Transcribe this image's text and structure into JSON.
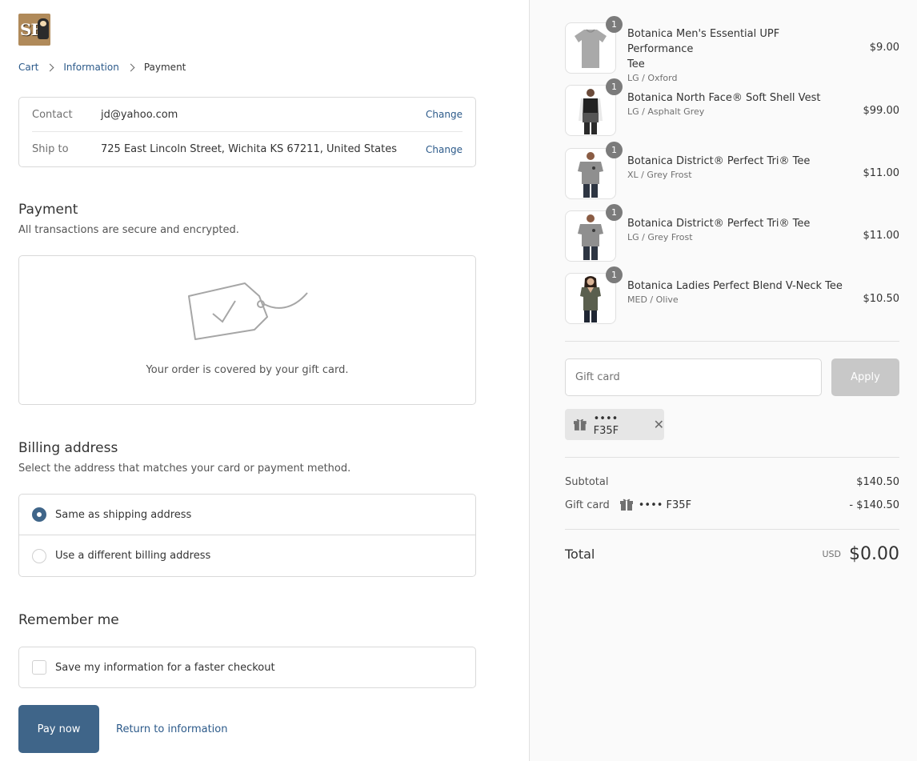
{
  "logo": {
    "text": "SF"
  },
  "breadcrumb": {
    "cart": "Cart",
    "information": "Information",
    "payment": "Payment"
  },
  "review": {
    "contact_label": "Contact",
    "contact_value": "jd@yahoo.com",
    "ship_label": "Ship to",
    "ship_value": "725 East Lincoln Street, Wichita KS 67211, United States",
    "change_label": "Change"
  },
  "payment": {
    "title": "Payment",
    "subtitle": "All transactions are secure and encrypted.",
    "note": "Your order is covered by your gift card."
  },
  "billing": {
    "title": "Billing address",
    "subtitle": "Select the address that matches your card or payment method.",
    "options": [
      {
        "label": "Same as shipping address",
        "selected": true
      },
      {
        "label": "Use a different billing address",
        "selected": false
      }
    ]
  },
  "remember": {
    "title": "Remember me",
    "checkbox_label": "Save my information for a faster checkout"
  },
  "actions": {
    "pay_label": "Pay now",
    "return_label": "Return to information"
  },
  "products": [
    {
      "name_line1": "Botanica Men's Essential UPF Performance",
      "name_line2": "Tee",
      "variant": "LG / Oxford",
      "price": "$9.00",
      "qty": "1"
    },
    {
      "name_line1": "Botanica North Face® Soft Shell Vest",
      "variant": "LG / Asphalt Grey",
      "price": "$99.00",
      "qty": "1"
    },
    {
      "name_line1": "Botanica District® Perfect Tri® Tee",
      "variant": "XL / Grey Frost",
      "price": "$11.00",
      "qty": "1"
    },
    {
      "name_line1": "Botanica District® Perfect Tri® Tee",
      "variant": "LG / Grey Frost",
      "price": "$11.00",
      "qty": "1"
    },
    {
      "name_line1": "Botanica Ladies Perfect Blend V-Neck Tee",
      "variant": "MED / Olive",
      "price": "$10.50",
      "qty": "1"
    }
  ],
  "gift": {
    "placeholder": "Gift card",
    "apply_label": "Apply",
    "applied_code": "•••• F35F",
    "remove_symbol": "✕"
  },
  "summary": {
    "subtotal_label": "Subtotal",
    "subtotal_value": "$140.50",
    "gift_label": "Gift card",
    "gift_code": "•••• F35F",
    "gift_value": "- $140.50",
    "total_label": "Total",
    "currency": "USD",
    "total_value": "$0.00"
  },
  "colors": {
    "accent": "#3f6589",
    "link": "#2c5a8a",
    "sidebar_bg": "#fafafa"
  }
}
